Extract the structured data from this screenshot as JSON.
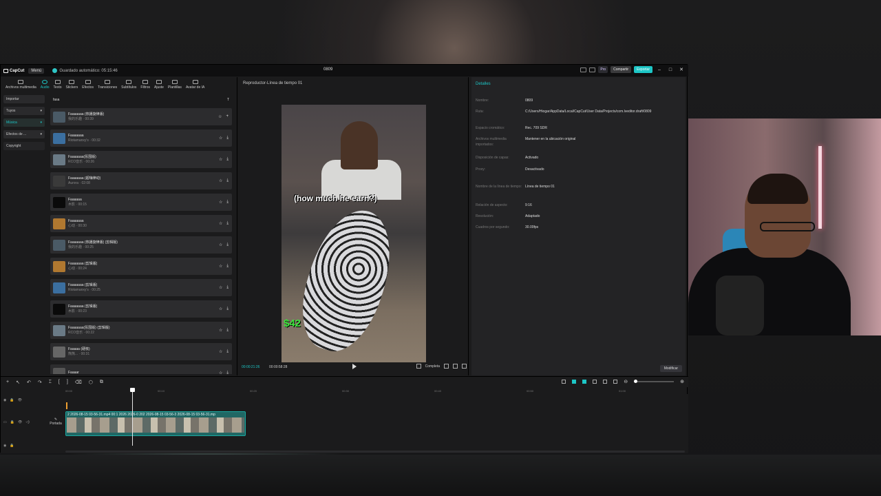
{
  "titlebar": {
    "logo": "CapCut",
    "menu": "Menú",
    "autosave": "Guardado automático: 05:15:46",
    "project": "0809",
    "pro": "Pro",
    "share": "Compartir",
    "export": "Exportar"
  },
  "tools": [
    "Archivos multimedia",
    "Audio",
    "Texto",
    "Stickers",
    "Efectos",
    "Transiciones",
    "Subtítulos",
    "Filtros",
    "Ajuste",
    "Plantillas",
    "Avatar de IA"
  ],
  "sidenav": [
    "Importar",
    "Tuyos",
    "Música",
    "Efectos de ...",
    "Copyright"
  ],
  "search": {
    "query": "fasa",
    "filter": "T"
  },
  "audio_list": [
    {
      "title": "Faaaaaaa (热播旋律版)",
      "meta": "我的乐趣 · 00:39"
    },
    {
      "title": "Faaaaaaa",
      "meta": "Riotamanxy's · 00:32"
    },
    {
      "title": "Faaaaaaa(氛围版)",
      "meta": "RCO音乐 · 00:26"
    },
    {
      "title": "Faaaaaaa (超嗨律动)",
      "meta": "Aurora · 02:08"
    },
    {
      "title": "Faaaaaa",
      "meta": "木影 · 00:15"
    },
    {
      "title": "Faaaaaaa",
      "meta": "心动 · 00:30"
    },
    {
      "title": "Faaaaaaa (热播旋律版) (剪辑版)",
      "meta": "我的乐趣 · 00:25"
    },
    {
      "title": "Faaaaaaa (剪辑版)",
      "meta": "心动 · 00:24"
    },
    {
      "title": "Faaaaaaa (剪辑版)",
      "meta": "Riotamanxy's · 00:25"
    },
    {
      "title": "Faaaaaaa (剪辑版)",
      "meta": "木影 · 00:23"
    },
    {
      "title": "Faaaaaaa(氛围版) (剪辑版)",
      "meta": "RCO音乐 · 00:22"
    },
    {
      "title": "Faaaaa (硬核)",
      "meta": "熊熊... · 00:31"
    },
    {
      "title": "Faaaar",
      "meta": ""
    }
  ],
  "player": {
    "title": "Reproductor-Línea de tiempo 01",
    "caption": "(how much he earn?)",
    "money": "$42",
    "current_time": "00:00:21:26",
    "total_time": "00:00:58:28",
    "ratio_btn": "Completa"
  },
  "details": {
    "title": "Detalles",
    "rows": [
      {
        "k": "Nombre:",
        "v": "0809"
      },
      {
        "k": "Ruta:",
        "v": "C:/Users/Hiogar/AppData/Local/CapCut/User Data/Projects/com.lveditor.draft/0809"
      },
      {
        "k": "Espacio cromático:",
        "v": "Rec. 709 SDR"
      },
      {
        "k": "Archivos multimedia importados:",
        "v": "Mantener en la ubicación original"
      },
      {
        "k": "Disposición de capas:",
        "v": "Activado"
      },
      {
        "k": "Proxy:",
        "v": "Desactivado"
      },
      {
        "k": "Nombre de la línea de tiempo:",
        "v": "Línea de tiempo 01"
      },
      {
        "k": "Relación de aspecto:",
        "v": "9:16"
      },
      {
        "k": "Resolución:",
        "v": "Adaptado"
      },
      {
        "k": "Cuadros por segundo:",
        "v": "30.00fps"
      }
    ],
    "modify": "Modificar"
  },
  "timeline": {
    "ruler": [
      "00:00",
      "00:10",
      "00:20",
      "00:30",
      "00:40",
      "00:50",
      "01:00"
    ],
    "clip_label": "2  2026-08-15 03-56-31.mp4  00:1  2026  2026-0  202  2026-08-15 03-56-3  2026-08-15 03-56-31.mp",
    "cover": "Portada"
  }
}
